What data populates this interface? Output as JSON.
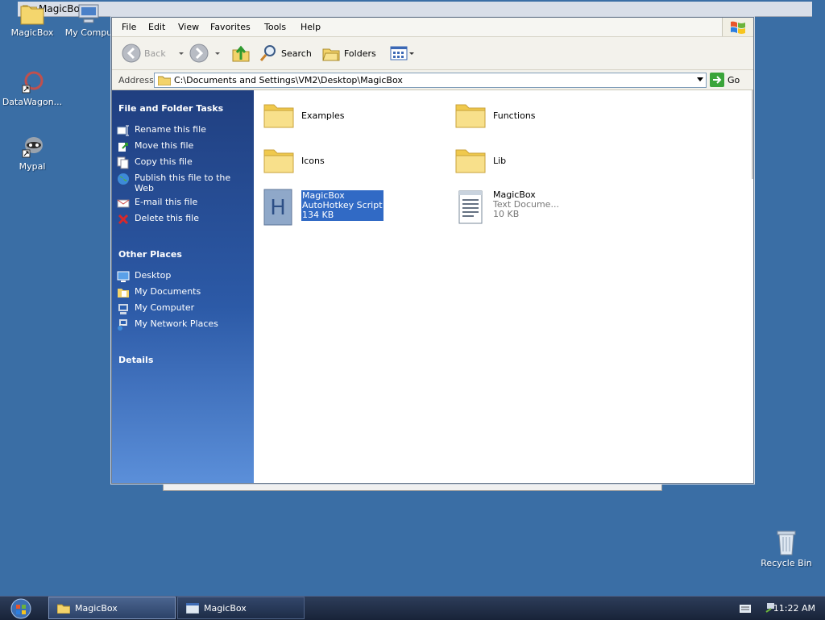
{
  "background_window": {
    "title": "MagicBox"
  },
  "desktop": {
    "icons": [
      {
        "label": "MagicBox"
      },
      {
        "label": "My Compu"
      },
      {
        "label": "DataWagon..."
      },
      {
        "label": "Mypal"
      },
      {
        "label": "Recycle Bin"
      }
    ]
  },
  "menu": [
    "File",
    "Edit",
    "View",
    "Favorites",
    "Tools",
    "Help"
  ],
  "toolbar": {
    "back_label": "Back",
    "search_label": "Search",
    "folders_label": "Folders"
  },
  "address": {
    "label": "Address",
    "path": "C:\\Documents and Settings\\VM2\\Desktop\\MagicBox",
    "go_label": "Go"
  },
  "taskpane": {
    "file_tasks_title": "File and Folder Tasks",
    "file_tasks": [
      "Rename this file",
      "Move this file",
      "Copy this file",
      "Publish this file to the Web",
      "E-mail this file",
      "Delete this file"
    ],
    "other_places_title": "Other Places",
    "other_places": [
      "Desktop",
      "My Documents",
      "My Computer",
      "My Network Places"
    ],
    "details_title": "Details"
  },
  "files": [
    {
      "name": "Examples",
      "type": "",
      "size": ""
    },
    {
      "name": "Functions",
      "type": "",
      "size": ""
    },
    {
      "name": "Icons",
      "type": "",
      "size": ""
    },
    {
      "name": "Lib",
      "type": "",
      "size": ""
    },
    {
      "name": "MagicBox",
      "type": "AutoHotkey Script",
      "size": "134 KB"
    },
    {
      "name": "MagicBox",
      "type": "Text Docume...",
      "size": "10 KB"
    }
  ],
  "taskbar": {
    "buttons": [
      {
        "label": "MagicBox"
      },
      {
        "label": "MagicBox"
      }
    ],
    "clock": "11:22 AM"
  },
  "colors": {
    "desktop": "#3a6ea5",
    "selection": "#316ac5",
    "taskpane_top": "#203f80"
  }
}
